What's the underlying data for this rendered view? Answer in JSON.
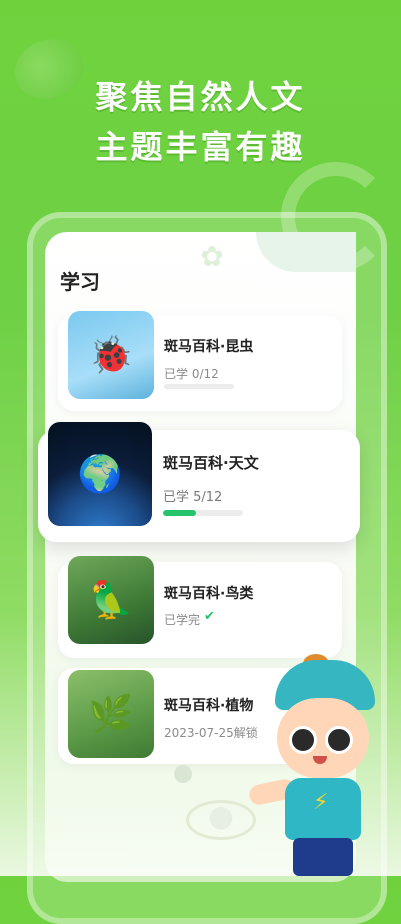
{
  "headline": {
    "line1": "聚焦自然人文",
    "line2": "主题丰富有趣"
  },
  "screen": {
    "section_title": "学习",
    "cards": [
      {
        "title": "斑马百科·昆虫",
        "status": "已学 0/12",
        "progress": 0,
        "thumb_icon": "ladybug-icon"
      },
      {
        "title": "斑马百科·天文",
        "status": "已学 5/12",
        "progress": 0.4167,
        "thumb_icon": "earth-icon",
        "accent_color": "#25c46a"
      },
      {
        "title": "斑马百科·鸟类",
        "status": "已学完",
        "status_icon": "check-icon",
        "thumb_icon": "parrot-icon"
      },
      {
        "title": "斑马百科·植物",
        "status": "2023-07-25解锁",
        "thumb_icon": "venus-flytrap-icon"
      }
    ]
  },
  "colors": {
    "brand_green": "#6fd23d",
    "progress_green": "#25c46a"
  }
}
